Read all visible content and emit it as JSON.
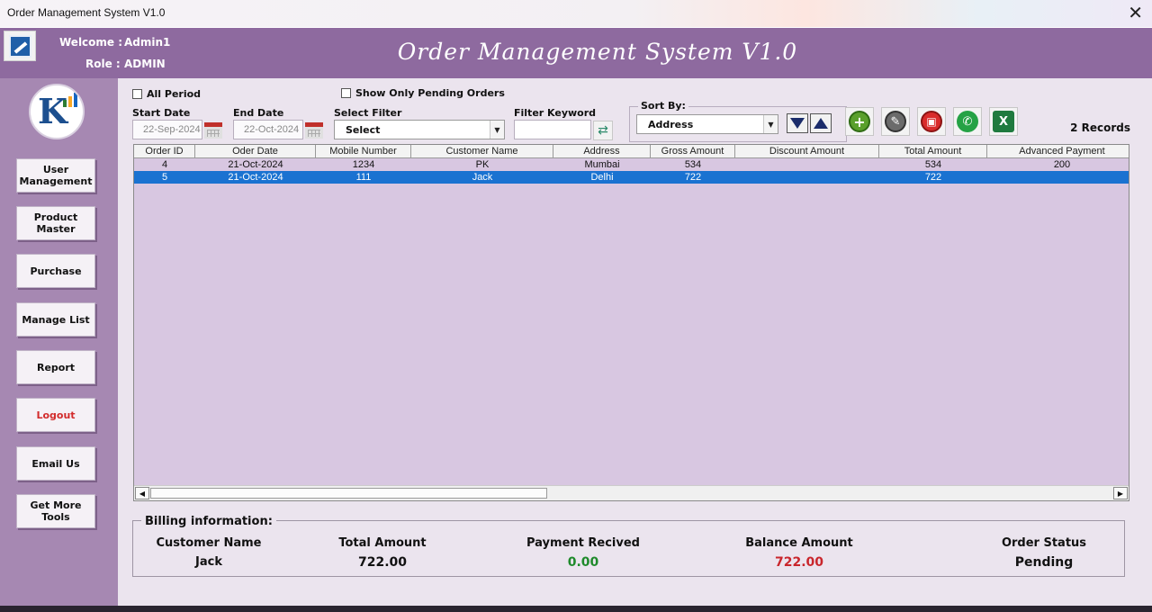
{
  "window": {
    "title": "Order Management System V1.0",
    "close_glyph": "✕"
  },
  "header": {
    "welcome_label": "Welcome :",
    "welcome_value": "Admin1",
    "role_label": "Role :",
    "role_value": "ADMIN",
    "app_title": "Order Management System V1.0"
  },
  "sidebar": {
    "buttons": [
      {
        "label": "User Management"
      },
      {
        "label": "Product Master"
      },
      {
        "label": "Purchase"
      },
      {
        "label": "Manage List"
      },
      {
        "label": "Report"
      },
      {
        "label": "Logout"
      },
      {
        "label": "Email Us"
      },
      {
        "label": "Get More Tools"
      }
    ]
  },
  "filters": {
    "all_period": "All Period",
    "pending_only": "Show Only Pending Orders",
    "start_date_label": "Start Date",
    "start_date_value": "22-Sep-2024",
    "end_date_label": "End Date",
    "end_date_value": "22-Oct-2024",
    "select_filter_label": "Select Filter",
    "select_filter_value": "Select",
    "keyword_label": "Filter Keyword",
    "keyword_value": ""
  },
  "sort": {
    "label": "Sort By:",
    "value": "Address"
  },
  "records_text": "2 Records",
  "grid": {
    "columns": [
      "Order ID",
      "Oder Date",
      "Mobile Number",
      "Customer Name",
      "Address",
      "Gross Amount",
      "Discount Amount",
      "Total Amount",
      "Advanced Payment"
    ],
    "rows": [
      {
        "cells": [
          "4",
          "21-Oct-2024",
          "1234",
          "PK",
          "Mumbai",
          "534",
          "",
          "534",
          "200"
        ],
        "selected": false
      },
      {
        "cells": [
          "5",
          "21-Oct-2024",
          "111",
          "Jack",
          "Delhi",
          "722",
          "",
          "722",
          ""
        ],
        "selected": true
      }
    ]
  },
  "billing": {
    "legend": "Billing information:",
    "customer_name_label": "Customer Name",
    "customer_name_value": "Jack",
    "total_amount_label": "Total Amount",
    "total_amount_value": "722.00",
    "payment_label": "Payment Recived",
    "payment_value": "0.00",
    "balance_label": "Balance Amount",
    "balance_value": "722.00",
    "status_label": "Order Status",
    "status_value": "Pending"
  },
  "colors": {
    "header_bg": "#8e6a9f",
    "sidebar_bg": "#a688b2",
    "main_bg": "#ebe4ee",
    "grid_bg": "#d8c7e1",
    "selected_row": "#1a72d1",
    "payment_green": "#1f8a2b",
    "balance_red": "#c9262c",
    "logout_red": "#d22b2b"
  },
  "icons": {
    "add": "plus-circle-icon",
    "edit": "pencil-icon",
    "delete": "trash-icon",
    "whatsapp": "whatsapp-icon",
    "excel": "excel-icon",
    "sort_desc": "sort-descending-icon",
    "sort_asc": "sort-ascending-icon",
    "refresh": "refresh-icon",
    "calendar": "calendar-icon"
  }
}
